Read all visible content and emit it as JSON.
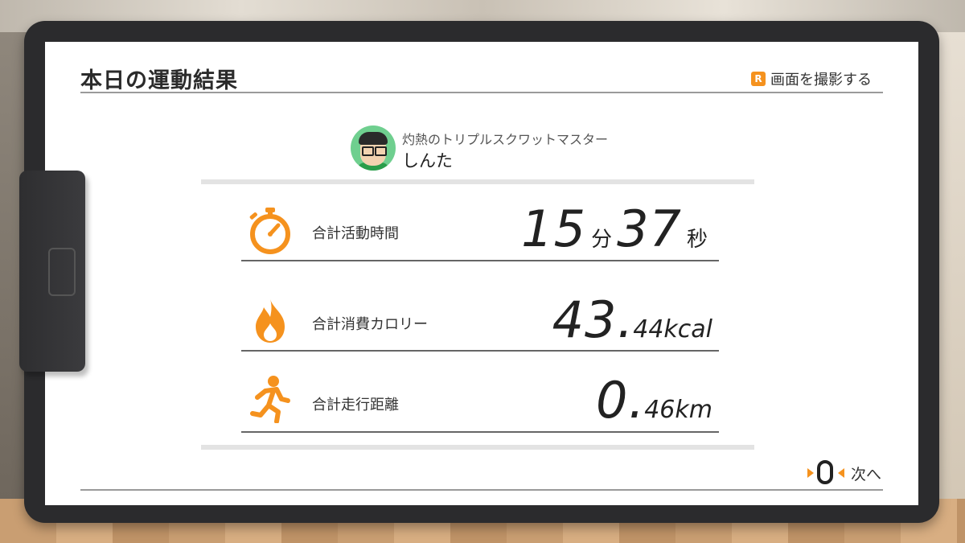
{
  "colors": {
    "accent": "#f5921e",
    "text": "#222222",
    "rule": "#666666"
  },
  "header": {
    "title": "本日の運動結果",
    "screenshot_badge": "R",
    "screenshot_label": "画面を撮影する"
  },
  "profile": {
    "title": "灼熱のトリプルスクワットマスター",
    "name": "しんた",
    "avatar_icon": "mii-avatar-icon"
  },
  "stats": [
    {
      "icon": "stopwatch-icon",
      "label": "合計活動時間",
      "value_minutes": "15",
      "unit_minutes": "分",
      "value_seconds": "37",
      "unit_seconds": "秒"
    },
    {
      "icon": "flame-icon",
      "label": "合計消費カロリー",
      "value_int": "43",
      "value_dot": ".",
      "value_frac": "44kcal"
    },
    {
      "icon": "runner-icon",
      "label": "合計走行距離",
      "value_int": "0",
      "value_dot": ".",
      "value_frac": "46km"
    }
  ],
  "footer": {
    "next_label": "次へ",
    "next_icon": "ring-con-icon"
  }
}
